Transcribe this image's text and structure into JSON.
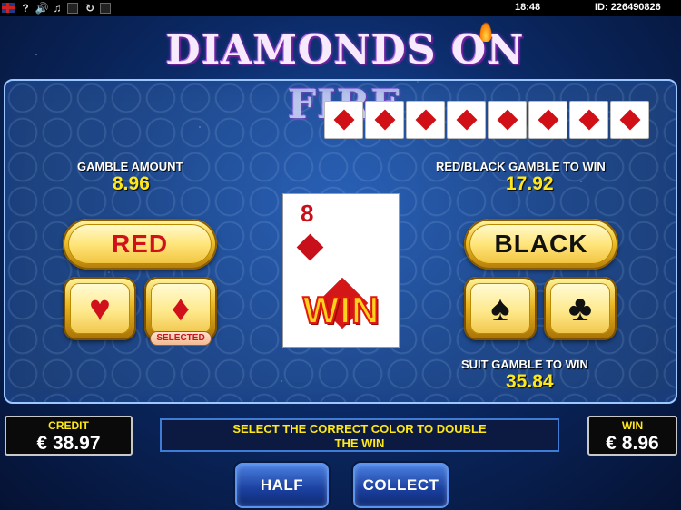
{
  "topbar": {
    "icons": [
      "uk-flag-icon",
      "help-icon",
      "sound-icon",
      "music-icon",
      "stop-icon",
      "refresh-icon",
      "exit-icon"
    ],
    "help_glyph": "?",
    "time": "18:48",
    "id_label": "ID: 226490826"
  },
  "game": {
    "title": "DIAMONDS ON FIRE"
  },
  "history": [
    "diamond",
    "diamond",
    "diamond",
    "diamond",
    "diamond",
    "diamond",
    "diamond",
    "diamond"
  ],
  "gamble": {
    "amount_label": "GAMBLE AMOUNT",
    "amount_value": "8.96",
    "redblack_label": "RED/BLACK GAMBLE TO WIN",
    "redblack_value": "17.92",
    "suit_label": "SUIT GAMBLE TO WIN",
    "suit_value": "35.84"
  },
  "buttons": {
    "red": "RED",
    "black": "BLACK",
    "selected_tag": "SELECTED",
    "half": "HALF",
    "collect": "COLLECT"
  },
  "card": {
    "rank": "8",
    "suit": "diamond",
    "result": "WIN"
  },
  "credit": {
    "label": "CREDIT",
    "value": "€ 38.97"
  },
  "win": {
    "label": "WIN",
    "value": "€ 8.96"
  },
  "message": {
    "line1": "SELECT THE CORRECT COLOR TO DOUBLE",
    "line2": "THE WIN"
  },
  "colors": {
    "red_suit": "#c8101a",
    "accent_yellow": "#ffe81a",
    "gold": "#f0c02a"
  }
}
